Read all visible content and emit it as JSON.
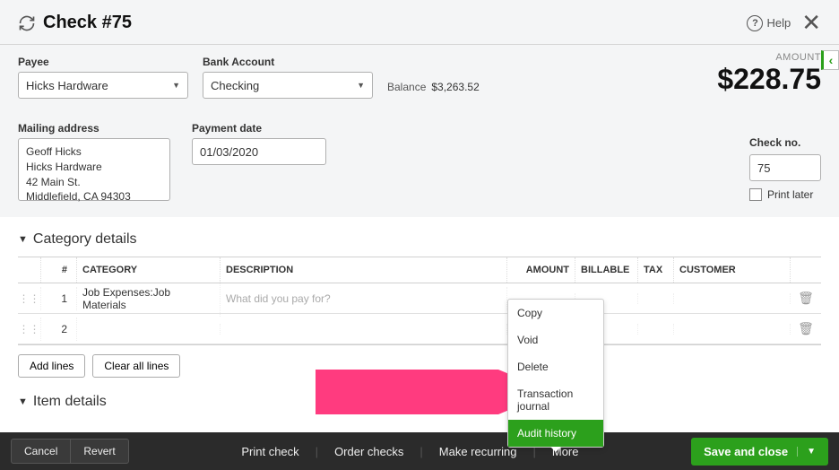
{
  "header": {
    "title": "Check #75",
    "help": "Help"
  },
  "payee": {
    "label": "Payee",
    "value": "Hicks Hardware"
  },
  "bank": {
    "label": "Bank Account",
    "value": "Checking"
  },
  "balance": {
    "label": "Balance",
    "value": "$3,263.52"
  },
  "amount": {
    "label": "AMOUNT",
    "value": "$228.75"
  },
  "mailing": {
    "label": "Mailing address",
    "value": "Geoff Hicks\nHicks Hardware\n42 Main St.\nMiddlefield, CA  94303"
  },
  "payment_date": {
    "label": "Payment date",
    "value": "01/03/2020"
  },
  "checkno": {
    "label": "Check no.",
    "value": "75",
    "print_later": "Print later"
  },
  "category_section": {
    "title": "Category details",
    "columns": {
      "num": "#",
      "cat": "CATEGORY",
      "desc": "DESCRIPTION",
      "amt": "AMOUNT",
      "bill": "BILLABLE",
      "tax": "TAX",
      "cust": "CUSTOMER"
    },
    "rows": [
      {
        "num": "1",
        "category": "Job Expenses:Job Materials",
        "desc_placeholder": "What did you pay for?"
      },
      {
        "num": "2",
        "category": "",
        "desc_placeholder": ""
      }
    ],
    "add_lines": "Add lines",
    "clear_all": "Clear all lines"
  },
  "item_section": {
    "title": "Item details"
  },
  "footer": {
    "cancel": "Cancel",
    "revert": "Revert",
    "print_check": "Print check",
    "order_checks": "Order checks",
    "make_recurring": "Make recurring",
    "more": "More",
    "save": "Save and close"
  },
  "menu": {
    "copy": "Copy",
    "void": "Void",
    "delete": "Delete",
    "journal": "Transaction journal",
    "audit": "Audit history"
  }
}
